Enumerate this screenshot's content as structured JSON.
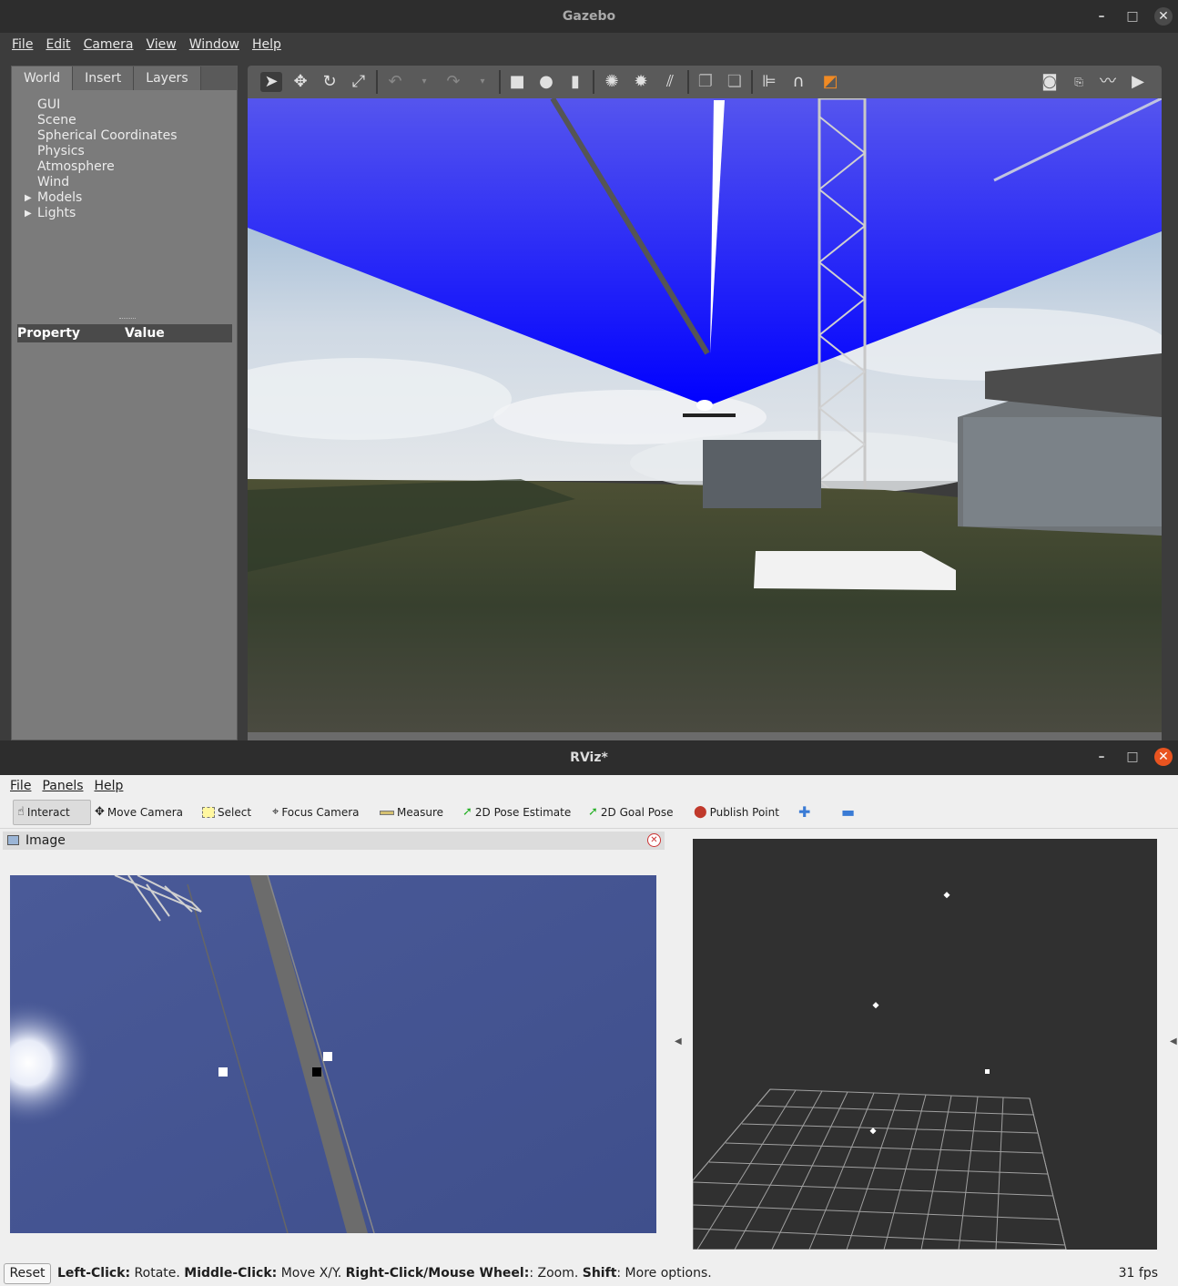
{
  "gazebo": {
    "title": "Gazebo",
    "menu": [
      "File",
      "Edit",
      "Camera",
      "View",
      "Window",
      "Help"
    ],
    "tabs": [
      "World",
      "Insert",
      "Layers"
    ],
    "tree": [
      "GUI",
      "Scene",
      "Spherical Coordinates",
      "Physics",
      "Atmosphere",
      "Wind",
      "Models",
      "Lights"
    ],
    "property_header": {
      "property": "Property",
      "value": "Value"
    },
    "toolbar_icons": [
      "select-arrow",
      "translate",
      "rotate",
      "scale",
      "undo",
      "redo",
      "box",
      "sphere",
      "cylinder",
      "point-light",
      "spot-light",
      "directional-light",
      "copy",
      "paste",
      "align",
      "snap",
      "view-angle",
      "screenshot",
      "log",
      "plot",
      "video-record"
    ]
  },
  "rviz": {
    "title": "RViz*",
    "menu": [
      "File",
      "Panels",
      "Help"
    ],
    "tools": [
      {
        "label": "Interact",
        "icon": "hand-icon"
      },
      {
        "label": "Move Camera",
        "icon": "move-camera-icon"
      },
      {
        "label": "Select",
        "icon": "select-icon"
      },
      {
        "label": "Focus Camera",
        "icon": "focus-camera-icon"
      },
      {
        "label": "Measure",
        "icon": "ruler-icon"
      },
      {
        "label": "2D Pose Estimate",
        "icon": "pose-arrow-icon"
      },
      {
        "label": "2D Goal Pose",
        "icon": "goal-arrow-icon"
      },
      {
        "label": "Publish Point",
        "icon": "map-pin-icon"
      }
    ],
    "image_panel_title": "Image",
    "status": {
      "reset": "Reset",
      "left_click_label": "Left-Click:",
      "left_click_text": " Rotate. ",
      "middle_click_label": "Middle-Click:",
      "middle_click_text": " Move X/Y. ",
      "right_click_label": "Right-Click/Mouse Wheel:",
      "right_click_text": ": Zoom. ",
      "shift_label": "Shift",
      "shift_text": ": More options.",
      "fps": "31 fps"
    }
  },
  "colors": {
    "laser_blue": "#0000ff",
    "camera_sky": "#4a5a98",
    "rviz_bg": "#303030",
    "ubuntu_close": "#e95420"
  }
}
